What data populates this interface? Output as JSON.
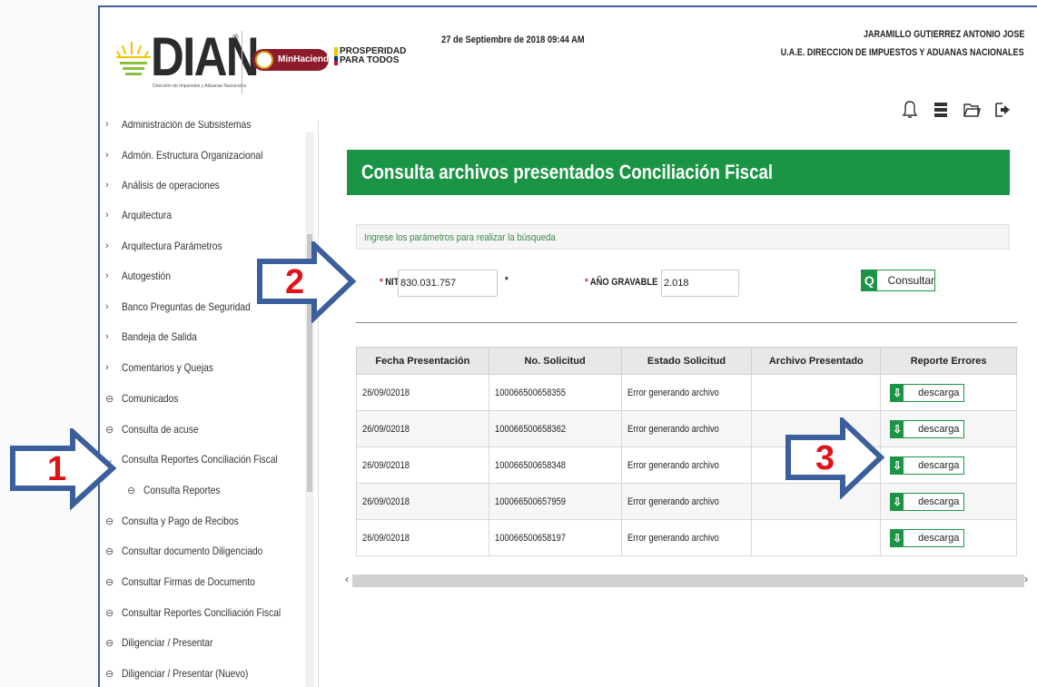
{
  "header": {
    "logo_text": "DIAN",
    "logo_registered": "®",
    "logo_subtitle": "Dirección de Impuestos y Aduanas Nacionales",
    "partner_logo": "MinHacienda",
    "slogan_line1": "PROSPERIDAD",
    "slogan_line2": "PARA TODOS",
    "datetime": "27 de Septiembre de 2018 09:44 AM",
    "user_name": "JARAMILLO GUTIERREZ ANTONIO JOSE",
    "user_org": "U.A.E. DIRECCION DE IMPUESTOS Y ADUANAS NACIONALES",
    "icons": [
      "bell-icon",
      "server-icon",
      "folder-icon",
      "logout-icon"
    ]
  },
  "sidebar": {
    "items": [
      {
        "label": "Administración de Subsistemas",
        "type": "group"
      },
      {
        "label": "Admón. Estructura Organizacional",
        "type": "group"
      },
      {
        "label": "Análisis de operaciones",
        "type": "group"
      },
      {
        "label": "Arquitectura",
        "type": "group"
      },
      {
        "label": "Arquitectura Parámetros",
        "type": "group"
      },
      {
        "label": "Autogestión",
        "type": "group"
      },
      {
        "label": "Banco Preguntas de Seguridad",
        "type": "group"
      },
      {
        "label": "Bandeja de Salida",
        "type": "group"
      },
      {
        "label": "Comentarios y Quejas",
        "type": "group"
      },
      {
        "label": "Comunicados",
        "type": "link"
      },
      {
        "label": "Consulta de acuse",
        "type": "link"
      },
      {
        "label": "Consulta Reportes Conciliación Fiscal",
        "type": "expanded"
      },
      {
        "label": "Consulta Reportes",
        "type": "child"
      },
      {
        "label": "Consulta y Pago de Recibos",
        "type": "link"
      },
      {
        "label": "Consultar documento Diligenciado",
        "type": "link"
      },
      {
        "label": "Consultar Firmas de Documento",
        "type": "link"
      },
      {
        "label": "Consultar Reportes Conciliación Fiscal",
        "type": "link"
      },
      {
        "label": "Diligenciar / Presentar",
        "type": "link"
      },
      {
        "label": "Diligenciar / Presentar (Nuevo)",
        "type": "link"
      }
    ]
  },
  "main": {
    "title": "Consulta archivos presentados Conciliación Fiscal",
    "instructions": "Ingrese los parámetros para realizar la búsqueda",
    "nit_label": "NIT",
    "nit_value": "830.031.757",
    "required_mark": "*",
    "year_label": "AÑO GRAVABLE",
    "year_value": "2.018",
    "consultar_label": "Consultar",
    "table": {
      "headers": [
        "Fecha Presentación",
        "No. Solicitud",
        "Estado Solicitud",
        "Archivo Presentado",
        "Reporte Errores"
      ],
      "rows": [
        {
          "fecha": "26/09/02018",
          "solicitud": "100066500658355",
          "estado": "Error generando archivo",
          "archivo": "",
          "reporte": "descarga"
        },
        {
          "fecha": "26/09/02018",
          "solicitud": "100066500658362",
          "estado": "Error generando archivo",
          "archivo": "",
          "reporte": "descarga"
        },
        {
          "fecha": "26/09/02018",
          "solicitud": "100066500658348",
          "estado": "Error generando archivo",
          "archivo": "",
          "reporte": "descarga"
        },
        {
          "fecha": "26/09/02018",
          "solicitud": "100066500657959",
          "estado": "Error generando archivo",
          "archivo": "",
          "reporte": "descarga"
        },
        {
          "fecha": "26/09/02018",
          "solicitud": "100066500658197",
          "estado": "Error generando archivo",
          "archivo": "",
          "reporte": "descarga"
        }
      ]
    }
  },
  "annotations": {
    "step1": "1",
    "step2": "2",
    "step3": "3"
  },
  "colors": {
    "brand_green": "#1b9445",
    "annotation_arrow": "#3b5f9c",
    "annotation_number": "#e0131a"
  }
}
